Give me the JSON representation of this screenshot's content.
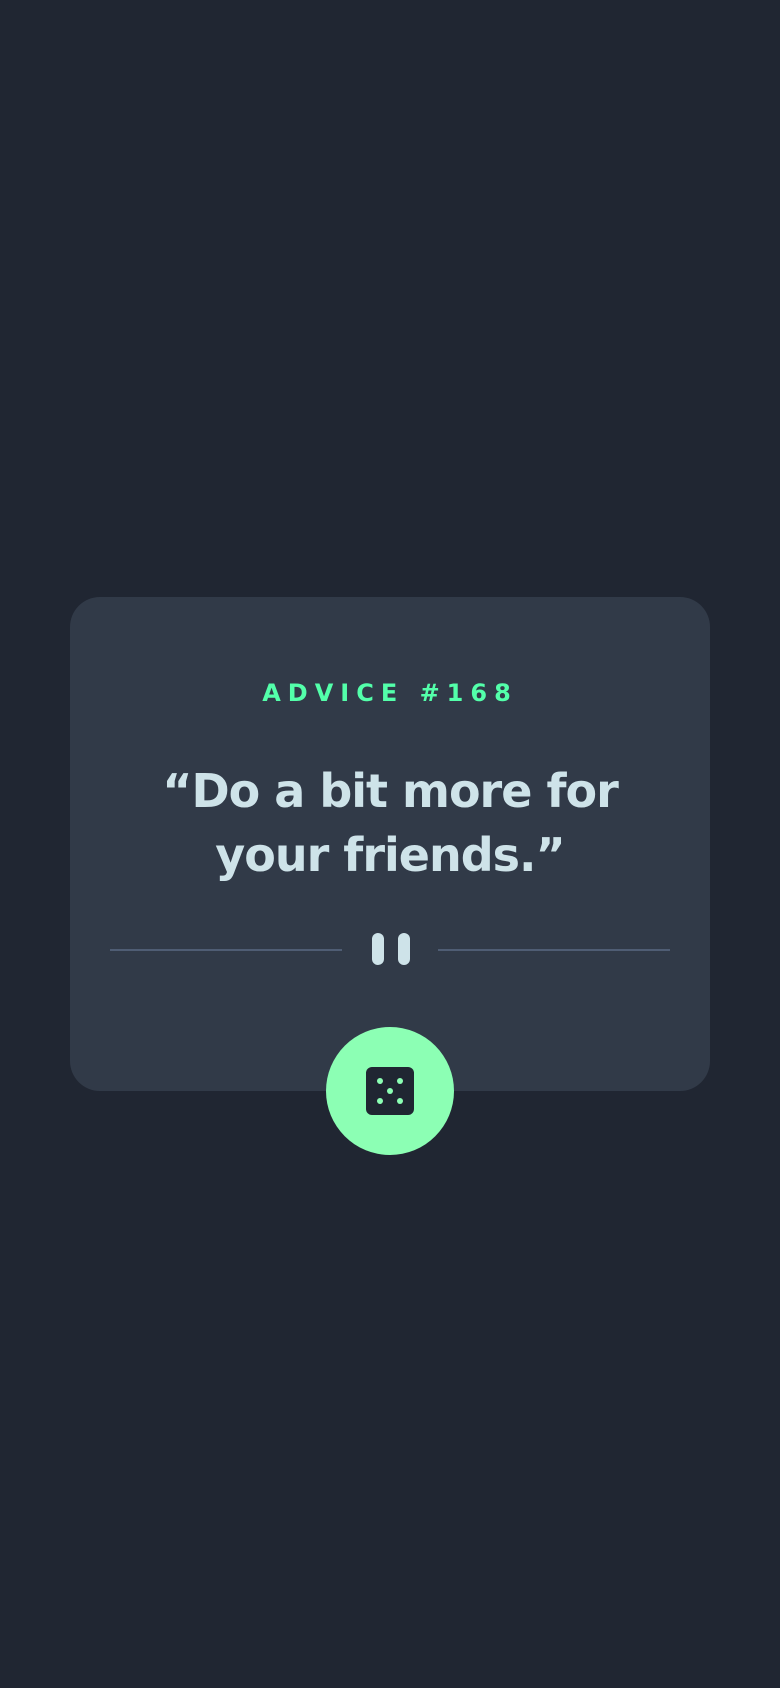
{
  "advice": {
    "label": "ADVICE #168",
    "quote": "“Do a bit more for your friends.”"
  },
  "icons": {
    "divider": "pause-icon",
    "button": "dice-icon"
  },
  "colors": {
    "background": "#202632",
    "card": "#313A48",
    "accent": "#53FFAA",
    "button": "#8CFFB4",
    "text": "#CEE3E9",
    "divider_line": "#4F5D74"
  }
}
